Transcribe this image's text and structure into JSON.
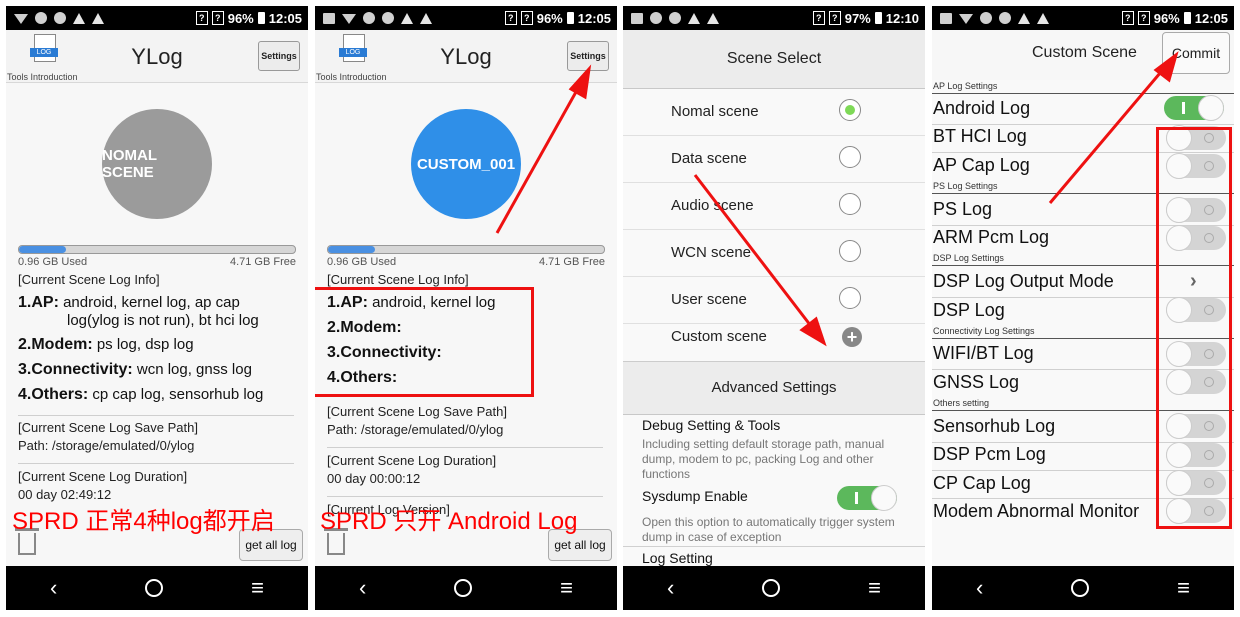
{
  "status_bars": [
    {
      "battery": "96%",
      "time": "12:05"
    },
    {
      "battery": "96%",
      "time": "12:05"
    },
    {
      "battery": "97%",
      "time": "12:10"
    },
    {
      "battery": "96%",
      "time": "12:05"
    }
  ],
  "status_q": "?",
  "nav": {
    "back": "‹",
    "menu": "≡"
  },
  "panel1": {
    "app_title": "YLog",
    "logo_tag": "LOG",
    "tools_intro": "Tools Introduction",
    "settings_label": "Settings",
    "scene_name": "NOMAL SCENE",
    "scene_color": "#9b9b9b",
    "storage_used": "0.96 GB Used",
    "storage_free": "4.71 GB Free",
    "storage_fraction": 0.17,
    "info_header": "[Current Scene Log Info]",
    "ap_label": "1.AP:",
    "ap_value_1": "android, kernel log, ap cap",
    "ap_value_2": "log(ylog is not run), bt hci log",
    "modem_label": "2.Modem:",
    "modem_value": "ps log, dsp log",
    "conn_label": "3.Connectivity:",
    "conn_value": "wcn log, gnss log",
    "others_label": "4.Others:",
    "others_value": "cp cap log, sensorhub log",
    "save_path_header": "[Current Scene Log Save Path]",
    "save_path": "Path: /storage/emulated/0/ylog",
    "duration_header": "[Current Scene Log Duration]",
    "duration": "00 day 02:49:12",
    "annotation": "SPRD 正常4种log都开启",
    "get_all_log": "get all log"
  },
  "panel2": {
    "app_title": "YLog",
    "logo_tag": "LOG",
    "tools_intro": "Tools Introduction",
    "settings_label": "Settings",
    "scene_name": "CUSTOM_001",
    "scene_color": "#2f8fe8",
    "storage_used": "0.96 GB Used",
    "storage_free": "4.71 GB Free",
    "storage_fraction": 0.17,
    "info_header": "[Current Scene Log Info]",
    "ap_label": "1.AP:",
    "ap_value": "android, kernel log",
    "modem_label": "2.Modem:",
    "conn_label": "3.Connectivity:",
    "others_label": "4.Others:",
    "save_path_header": "[Current Scene Log Save Path]",
    "save_path": "Path: /storage/emulated/0/ylog",
    "duration_header": "[Current Scene Log Duration]",
    "duration": "00 day 00:00:12",
    "version_header": "[Current Log Version]",
    "annotation": "SPRD 只开 Android Log",
    "get_all_log": "get all log"
  },
  "panel3": {
    "header": "Scene Select",
    "scenes": [
      {
        "label": "Nomal scene",
        "selected": true
      },
      {
        "label": "Data scene",
        "selected": false
      },
      {
        "label": "Audio scene",
        "selected": false
      },
      {
        "label": "WCN scene",
        "selected": false
      },
      {
        "label": "User scene",
        "selected": false
      },
      {
        "label": "Custom scene",
        "selected": false
      }
    ],
    "plus": "+",
    "advanced_header": "Advanced Settings",
    "debug_title": "Debug Setting & Tools",
    "debug_sub": "Including setting default storage path, manual dump, modem to pc, packing Log and other functions",
    "sysdump_title": "Sysdump Enable",
    "sysdump_on": true,
    "sysdump_sub": "Open this option to automatically trigger system dump in case of exception",
    "log_setting_title": "Log Setting"
  },
  "panel4": {
    "title": "Custom Scene",
    "commit": "Commit",
    "cat_ap": "AP Log Settings",
    "android_log": "Android Log",
    "android_log_on": true,
    "bt_hci_log": "BT HCI Log",
    "ap_cap_log": "AP Cap Log",
    "cat_ps": "PS Log Settings",
    "ps_log": "PS Log",
    "arm_pcm_log": "ARM Pcm Log",
    "cat_dsp": "DSP Log Settings",
    "dsp_output_mode": "DSP Log Output Mode",
    "dsp_log": "DSP Log",
    "cat_conn": "Connectivity Log Settings",
    "wifi_bt_log": "WIFI/BT Log",
    "gnss_log": "GNSS Log",
    "cat_others": "Others setting",
    "sensorhub_log": "Sensorhub Log",
    "dsp_pcm_log": "DSP Pcm Log",
    "cp_cap_log": "CP Cap Log",
    "modem_abnormal_monitor": "Modem Abnormal Monitor",
    "chevron": "›"
  },
  "colors": {
    "annotation_red": "#ff0000",
    "toggle_on": "#5cb85c",
    "radio_selected": "#7ed957"
  }
}
